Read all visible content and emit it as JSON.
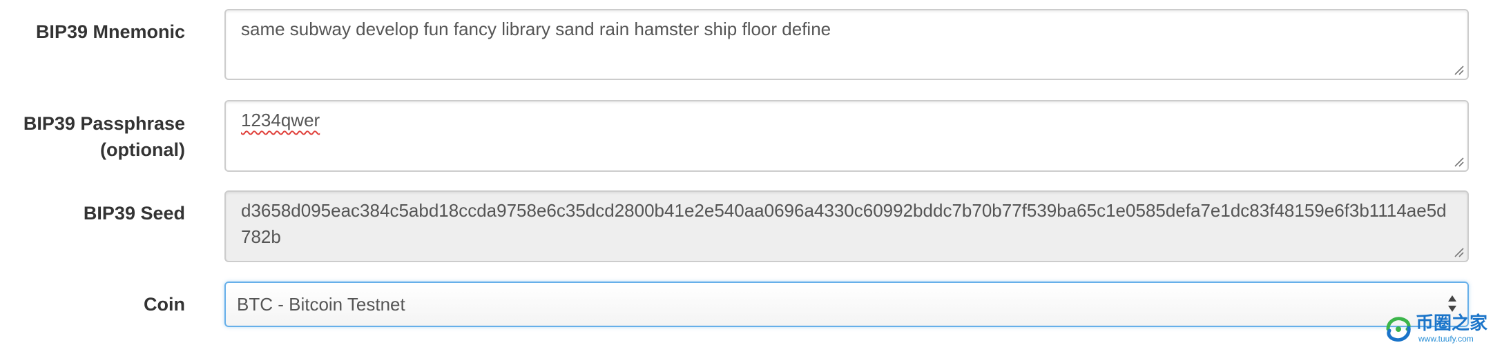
{
  "form": {
    "mnemonic": {
      "label": "BIP39 Mnemonic",
      "value": "same subway develop fun fancy library sand rain hamster ship floor define"
    },
    "passphrase": {
      "label_line1": "BIP39 Passphrase",
      "label_line2": "(optional)",
      "value": "1234qwer"
    },
    "seed": {
      "label": "BIP39 Seed",
      "value": "d3658d095eac384c5abd18ccda9758e6c35dcd2800b41e2e540aa0696a4330c60992bddc7b70b77f539ba65c1e0585defa7e1dc83f48159e6f3b1114ae5d782b"
    },
    "coin": {
      "label": "Coin",
      "selected": "BTC - Bitcoin Testnet"
    }
  },
  "watermark": {
    "title": "币圈之家",
    "url": "www.tuufy.com"
  },
  "colors": {
    "label_text": "#333333",
    "input_text": "#555555",
    "readonly_bg": "#eeeeee",
    "focus_border": "#66afe9",
    "spellcheck_underline": "#e0413c",
    "watermark_blue": "#1a74c9",
    "watermark_green": "#3bb54a"
  }
}
